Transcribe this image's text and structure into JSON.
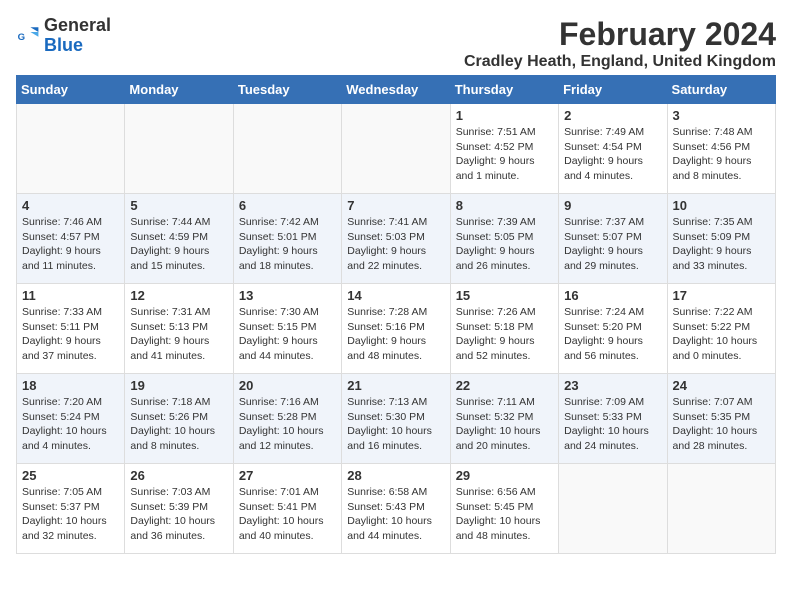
{
  "logo": {
    "line1": "General",
    "line2": "Blue"
  },
  "title": "February 2024",
  "location": "Cradley Heath, England, United Kingdom",
  "headers": [
    "Sunday",
    "Monday",
    "Tuesday",
    "Wednesday",
    "Thursday",
    "Friday",
    "Saturday"
  ],
  "weeks": [
    [
      {
        "day": "",
        "info": ""
      },
      {
        "day": "",
        "info": ""
      },
      {
        "day": "",
        "info": ""
      },
      {
        "day": "",
        "info": ""
      },
      {
        "day": "1",
        "info": "Sunrise: 7:51 AM\nSunset: 4:52 PM\nDaylight: 9 hours and 1 minute."
      },
      {
        "day": "2",
        "info": "Sunrise: 7:49 AM\nSunset: 4:54 PM\nDaylight: 9 hours and 4 minutes."
      },
      {
        "day": "3",
        "info": "Sunrise: 7:48 AM\nSunset: 4:56 PM\nDaylight: 9 hours and 8 minutes."
      }
    ],
    [
      {
        "day": "4",
        "info": "Sunrise: 7:46 AM\nSunset: 4:57 PM\nDaylight: 9 hours and 11 minutes."
      },
      {
        "day": "5",
        "info": "Sunrise: 7:44 AM\nSunset: 4:59 PM\nDaylight: 9 hours and 15 minutes."
      },
      {
        "day": "6",
        "info": "Sunrise: 7:42 AM\nSunset: 5:01 PM\nDaylight: 9 hours and 18 minutes."
      },
      {
        "day": "7",
        "info": "Sunrise: 7:41 AM\nSunset: 5:03 PM\nDaylight: 9 hours and 22 minutes."
      },
      {
        "day": "8",
        "info": "Sunrise: 7:39 AM\nSunset: 5:05 PM\nDaylight: 9 hours and 26 minutes."
      },
      {
        "day": "9",
        "info": "Sunrise: 7:37 AM\nSunset: 5:07 PM\nDaylight: 9 hours and 29 minutes."
      },
      {
        "day": "10",
        "info": "Sunrise: 7:35 AM\nSunset: 5:09 PM\nDaylight: 9 hours and 33 minutes."
      }
    ],
    [
      {
        "day": "11",
        "info": "Sunrise: 7:33 AM\nSunset: 5:11 PM\nDaylight: 9 hours and 37 minutes."
      },
      {
        "day": "12",
        "info": "Sunrise: 7:31 AM\nSunset: 5:13 PM\nDaylight: 9 hours and 41 minutes."
      },
      {
        "day": "13",
        "info": "Sunrise: 7:30 AM\nSunset: 5:15 PM\nDaylight: 9 hours and 44 minutes."
      },
      {
        "day": "14",
        "info": "Sunrise: 7:28 AM\nSunset: 5:16 PM\nDaylight: 9 hours and 48 minutes."
      },
      {
        "day": "15",
        "info": "Sunrise: 7:26 AM\nSunset: 5:18 PM\nDaylight: 9 hours and 52 minutes."
      },
      {
        "day": "16",
        "info": "Sunrise: 7:24 AM\nSunset: 5:20 PM\nDaylight: 9 hours and 56 minutes."
      },
      {
        "day": "17",
        "info": "Sunrise: 7:22 AM\nSunset: 5:22 PM\nDaylight: 10 hours and 0 minutes."
      }
    ],
    [
      {
        "day": "18",
        "info": "Sunrise: 7:20 AM\nSunset: 5:24 PM\nDaylight: 10 hours and 4 minutes."
      },
      {
        "day": "19",
        "info": "Sunrise: 7:18 AM\nSunset: 5:26 PM\nDaylight: 10 hours and 8 minutes."
      },
      {
        "day": "20",
        "info": "Sunrise: 7:16 AM\nSunset: 5:28 PM\nDaylight: 10 hours and 12 minutes."
      },
      {
        "day": "21",
        "info": "Sunrise: 7:13 AM\nSunset: 5:30 PM\nDaylight: 10 hours and 16 minutes."
      },
      {
        "day": "22",
        "info": "Sunrise: 7:11 AM\nSunset: 5:32 PM\nDaylight: 10 hours and 20 minutes."
      },
      {
        "day": "23",
        "info": "Sunrise: 7:09 AM\nSunset: 5:33 PM\nDaylight: 10 hours and 24 minutes."
      },
      {
        "day": "24",
        "info": "Sunrise: 7:07 AM\nSunset: 5:35 PM\nDaylight: 10 hours and 28 minutes."
      }
    ],
    [
      {
        "day": "25",
        "info": "Sunrise: 7:05 AM\nSunset: 5:37 PM\nDaylight: 10 hours and 32 minutes."
      },
      {
        "day": "26",
        "info": "Sunrise: 7:03 AM\nSunset: 5:39 PM\nDaylight: 10 hours and 36 minutes."
      },
      {
        "day": "27",
        "info": "Sunrise: 7:01 AM\nSunset: 5:41 PM\nDaylight: 10 hours and 40 minutes."
      },
      {
        "day": "28",
        "info": "Sunrise: 6:58 AM\nSunset: 5:43 PM\nDaylight: 10 hours and 44 minutes."
      },
      {
        "day": "29",
        "info": "Sunrise: 6:56 AM\nSunset: 5:45 PM\nDaylight: 10 hours and 48 minutes."
      },
      {
        "day": "",
        "info": ""
      },
      {
        "day": "",
        "info": ""
      }
    ]
  ]
}
